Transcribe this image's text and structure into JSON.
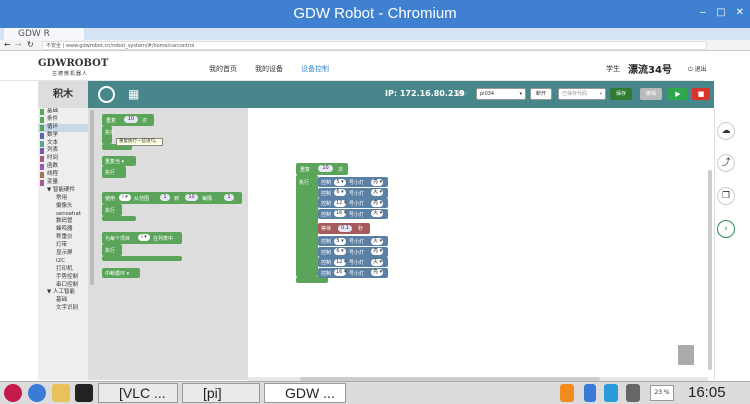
{
  "window": {
    "title": "GDW Robot - Chromium",
    "min": "‒",
    "max": "□",
    "close": "✕"
  },
  "browser": {
    "tab_title": "GDW R",
    "address_security": "不安全",
    "address_url": "www.gdwrobot.cn/robot_system/#/home/carcontrol"
  },
  "site": {
    "logo": "GDWROBOT",
    "logo_sub": "古德微机器人",
    "nav": [
      {
        "label": "我的首页"
      },
      {
        "label": "我的设备"
      },
      {
        "label": "设备控制"
      }
    ],
    "user_label": "学生",
    "user_name": "漂流34号",
    "logout": "退出"
  },
  "toolbar": {
    "ip": "IP: 172.16.80.219",
    "device_label": "设备：",
    "device_value": "pi034",
    "disconnect": "断开",
    "saved_code_placeholder": "已保存代码",
    "save": "保存",
    "gray_button": "撤销",
    "run": "▶",
    "stop": "■",
    "accent": "#47868b"
  },
  "categories": {
    "header": "积木",
    "items": [
      {
        "label": "基础",
        "color": "#5ba55b",
        "indent": false
      },
      {
        "label": "条件",
        "color": "#5ba55b",
        "indent": false
      },
      {
        "label": "循环",
        "color": "#5ba55b",
        "indent": false,
        "selected": true
      },
      {
        "label": "数学",
        "color": "#5b67a5",
        "indent": false
      },
      {
        "label": "文本",
        "color": "#5ba58c",
        "indent": false
      },
      {
        "label": "列表",
        "color": "#745ba5",
        "indent": false
      },
      {
        "label": "时间",
        "color": "#a55b80",
        "indent": false
      },
      {
        "label": "函数",
        "color": "#995ba5",
        "indent": false
      },
      {
        "label": "线程",
        "color": "#a5745b",
        "indent": false
      },
      {
        "label": "变量",
        "color": "#a55b99",
        "indent": false
      },
      {
        "label": "▼ 智能硬件",
        "color": "",
        "indent": false
      },
      {
        "label": "常用",
        "color": "",
        "indent": true
      },
      {
        "label": "摄像头",
        "color": "",
        "indent": true
      },
      {
        "label": "sensehat",
        "color": "",
        "indent": true
      },
      {
        "label": "数码管",
        "color": "",
        "indent": true
      },
      {
        "label": "蜂鸣器",
        "color": "",
        "indent": true
      },
      {
        "label": "称重仪",
        "color": "",
        "indent": true
      },
      {
        "label": "灯带",
        "color": "",
        "indent": true
      },
      {
        "label": "显示屏",
        "color": "",
        "indent": true
      },
      {
        "label": "I2C",
        "color": "",
        "indent": true
      },
      {
        "label": "打印机",
        "color": "",
        "indent": true
      },
      {
        "label": "手势控制",
        "color": "",
        "indent": true
      },
      {
        "label": "串口控制",
        "color": "",
        "indent": true
      },
      {
        "label": "▼ 人工智能",
        "color": "",
        "indent": false
      },
      {
        "label": "基础",
        "color": "",
        "indent": true
      },
      {
        "label": "文字识别",
        "color": "",
        "indent": true
      }
    ]
  },
  "flyout": {
    "repeat": {
      "label": "重复",
      "times": "10",
      "unit": "次",
      "do": "执行"
    },
    "tooltip": "重复执行一些语句。",
    "while": {
      "label": "重复当",
      "dd": "▾",
      "do": "执行"
    },
    "for_range": {
      "label": "使用",
      "var": "i ▾",
      "from": "从范围",
      "v1": "1",
      "to": "到",
      "v2": "10",
      "step": "每隔",
      "v3": "1",
      "do": "执行"
    },
    "for_each": {
      "label": "为每个项目",
      "var": "i ▾",
      "in": "在列表中",
      "do": "执行"
    },
    "break": {
      "label": "中断循环 ▾"
    }
  },
  "workspace": {
    "repeat_label": "重复",
    "repeat_times": "10",
    "repeat_unit": "次",
    "do_label": "执行",
    "control_label": "控制",
    "lamp_label": "号小灯",
    "wait_label": "等待",
    "wait_value": "0.1",
    "wait_unit": "秒",
    "rows_top": [
      {
        "pin": "5 ▾",
        "state": "亮 ▾"
      },
      {
        "pin": "6 ▾",
        "state": "灭 ▾"
      },
      {
        "pin": "12 ▾",
        "state": "亮 ▾"
      },
      {
        "pin": "16 ▾",
        "state": "灭 ▾"
      }
    ],
    "rows_bottom": [
      {
        "pin": "5 ▾",
        "state": "灭 ▾"
      },
      {
        "pin": "6 ▾",
        "state": "亮 ▾"
      },
      {
        "pin": "12 ▾",
        "state": "灭 ▾"
      },
      {
        "pin": "16 ▾",
        "state": "亮 ▾"
      }
    ]
  },
  "right_panel": {
    "upload": "☁",
    "share": "⤴",
    "copy": "❐",
    "back": "‹"
  },
  "taskbar": {
    "windows": [
      {
        "label": "[VLC ..."
      },
      {
        "label": "[pi]"
      },
      {
        "label": "GDW ..."
      }
    ],
    "cpu": "23 %",
    "clock": "16:05"
  }
}
